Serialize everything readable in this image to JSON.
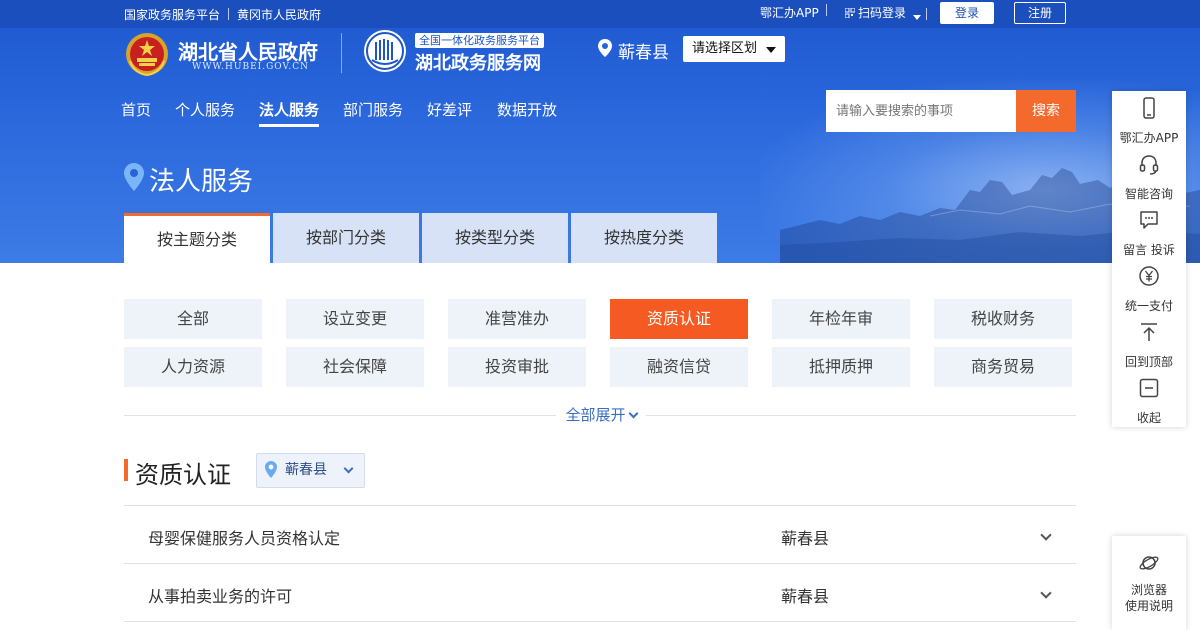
{
  "topbar": {
    "links": [
      "国家政务服务平台",
      "黄冈市人民政府"
    ],
    "app_link": "鄂汇办APP",
    "scan_login": "扫码登录",
    "login": "登录",
    "register": "注册"
  },
  "header": {
    "site_title": "湖北省人民政府",
    "site_url": "WWW.HUBEI.GOV.CN",
    "platform_badge": "全国一体化政务服务平台",
    "platform_name": "湖北政务服务网",
    "location": "蕲春县",
    "region_select": "请选择区划"
  },
  "nav": {
    "items": [
      "首页",
      "个人服务",
      "法人服务",
      "部门服务",
      "好差评",
      "数据开放"
    ],
    "active": "法人服务"
  },
  "search": {
    "placeholder": "请输入要搜索的事项",
    "button": "搜索"
  },
  "page_title": "法人服务",
  "class_tabs": [
    "按主题分类",
    "按部门分类",
    "按类型分类",
    "按热度分类"
  ],
  "categories": [
    [
      "全部",
      "设立变更",
      "准营准办",
      "资质认证",
      "年检年审",
      "税收财务"
    ],
    [
      "人力资源",
      "社会保障",
      "投资审批",
      "融资信贷",
      "抵押质押",
      "商务贸易"
    ]
  ],
  "active_category": "资质认证",
  "expand_all": "全部展开",
  "section": {
    "title": "资质认证",
    "area_filter": "蕲春县"
  },
  "results": [
    {
      "name": "母婴保健服务人员资格认定",
      "area": "蕲春县"
    },
    {
      "name": "从事拍卖业务的许可",
      "area": "蕲春县"
    }
  ],
  "float_toolbar": [
    {
      "icon": "phone-icon",
      "label": "鄂汇办APP"
    },
    {
      "icon": "headset-icon",
      "label": "智能咨询"
    },
    {
      "icon": "message-icon",
      "label": "留言 投诉"
    },
    {
      "icon": "yuan-icon",
      "label": "统一支付"
    },
    {
      "icon": "to-top-icon",
      "label": "回到顶部"
    },
    {
      "icon": "collapse-icon",
      "label": "收起"
    }
  ],
  "browser_help": [
    "浏览器",
    "使用说明"
  ],
  "colors": {
    "brand_blue": "#1d57cf",
    "accent_orange": "#f46a2c",
    "category_bg": "#eef2f9"
  }
}
